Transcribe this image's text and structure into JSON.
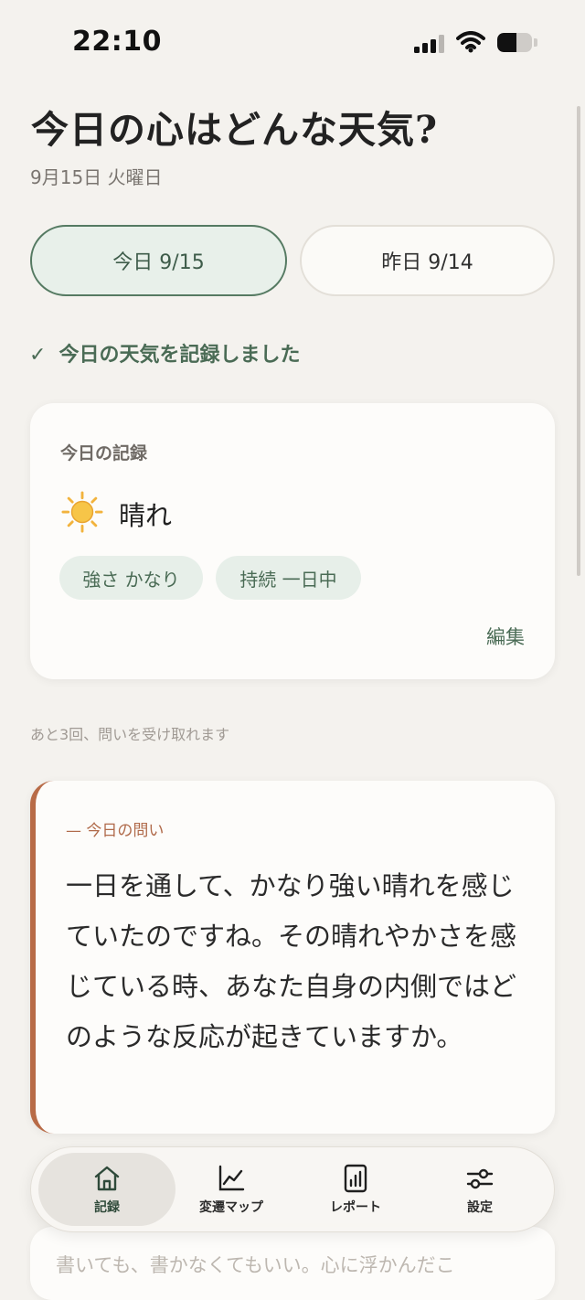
{
  "status": {
    "time": "22:10",
    "battery_level": 0.55
  },
  "header": {
    "title": "今日の心はどんな天気?",
    "date": "9月15日 火曜日"
  },
  "days": {
    "today": "今日 9/15",
    "yesterday": "昨日 9/14"
  },
  "saved_message": "今日の天気を記録しました",
  "record": {
    "label": "今日の記録",
    "weather_icon": "sun-icon",
    "weather": "晴れ",
    "chips": [
      "強さ かなり",
      "持続 一日中"
    ],
    "edit": "編集"
  },
  "remaining": "あと3回、問いを受け取れます",
  "question": {
    "label": "— 今日の問い",
    "text": "一日を通して、かなり強い晴れを感じていたのですね。その晴れやかさを感じている時、あなた自身の内側ではどのような反応が起きていますか。"
  },
  "input_placeholder": "書いても、書かなくてもいい。心に浮かんだこ",
  "nav": {
    "items": [
      {
        "label": "記録",
        "icon": "home-icon"
      },
      {
        "label": "変遷マップ",
        "icon": "line-chart-icon"
      },
      {
        "label": "レポート",
        "icon": "report-icon"
      },
      {
        "label": "設定",
        "icon": "sliders-icon"
      }
    ]
  },
  "colors": {
    "accent_green": "#4A6B55",
    "accent_terracotta": "#B86B47",
    "background": "#F4F2EE"
  }
}
